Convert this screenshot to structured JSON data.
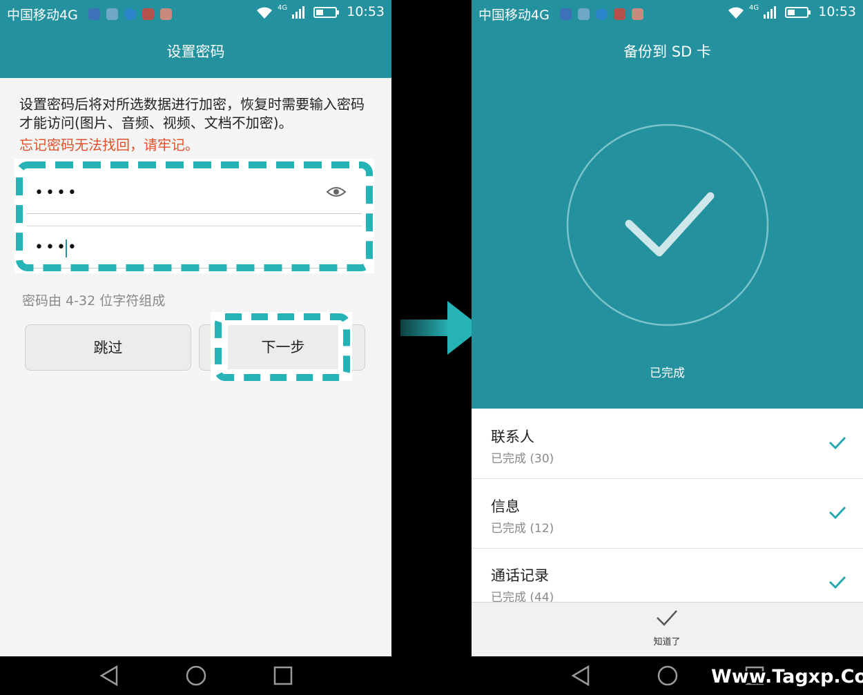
{
  "status_bar": {
    "carrier": "中国移动4G",
    "network": "4G",
    "time": "10:53"
  },
  "left_screen": {
    "title": "设置密码",
    "description": "设置密码后将对所选数据进行加密，恢复时需要输入密码才能访问(图片、音频、视频、文档不加密)。",
    "warning": "忘记密码无法找回，请牢记。",
    "password_value": "••••",
    "confirm_value": "••••",
    "hint": "密码由 4-32 位字符组成",
    "skip_label": "跳过",
    "next_label": "下一步"
  },
  "right_screen": {
    "title": "备份到 SD 卡",
    "status": "已完成",
    "items": [
      {
        "title": "联系人",
        "subtitle": "已完成 (30)"
      },
      {
        "title": "信息",
        "subtitle": "已完成 (12)"
      },
      {
        "title": "通话记录",
        "subtitle": "已完成 (44)"
      }
    ],
    "ok_label": "知道了"
  },
  "watermark": "Www.Tagxp.Com",
  "colors": {
    "teal": "#24929e",
    "warning": "#e0502a",
    "highlight": "#25b3b6"
  },
  "icons": [
    "signal-wifi-icon",
    "battery-icon",
    "eye-icon",
    "check-icon",
    "back-nav-icon",
    "home-nav-icon",
    "recent-nav-icon",
    "arrow-icon"
  ]
}
